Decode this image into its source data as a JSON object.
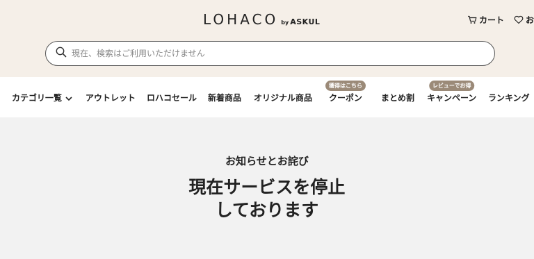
{
  "header": {
    "logo": {
      "main": "LOHACO",
      "by": "by",
      "brand": "ASKUL"
    },
    "cart_label": "カート",
    "favorites_label": "お",
    "cart_icon": "cart-icon",
    "favorites_icon": "heart-icon"
  },
  "search": {
    "placeholder": "現在、検索はご利用いただけません",
    "icon": "search-icon"
  },
  "nav": {
    "items": [
      {
        "label": "カテゴリ一覧"
      },
      {
        "label": "アウトレット"
      },
      {
        "label": "ロハコセール"
      },
      {
        "label": "新着商品"
      },
      {
        "label": "オリジナル商品"
      },
      {
        "label": "クーポン",
        "badge": "獲得はこちら"
      },
      {
        "label": "まとめ割"
      },
      {
        "label": "キャンペーン",
        "badge": "レビューでお得"
      },
      {
        "label": "ランキング"
      }
    ]
  },
  "notice": {
    "subtitle": "お知らせとお詫び",
    "title_line1": "現在サービスを停止",
    "title_line2": "しております"
  },
  "colors": {
    "header_bg": "#f5efe8",
    "badge_bg": "#9b8a78",
    "main_bg": "#f2f2f2"
  }
}
